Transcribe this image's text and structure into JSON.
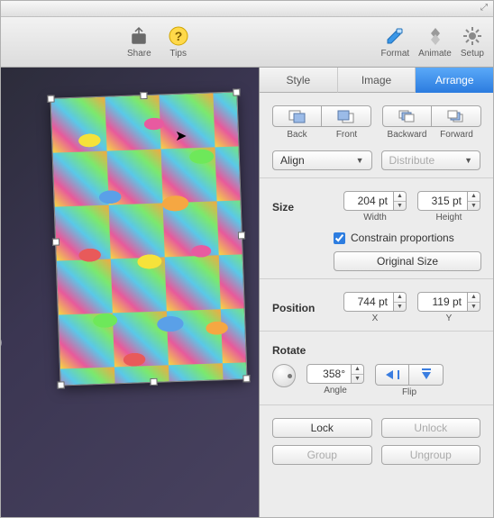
{
  "toolbar": {
    "share": "Share",
    "tips": "Tips",
    "format": "Format",
    "animate": "Animate",
    "setup": "Setup"
  },
  "inspector": {
    "tabs": {
      "style": "Style",
      "image": "Image",
      "arrange": "Arrange"
    },
    "order": {
      "back": "Back",
      "front": "Front",
      "backward": "Backward",
      "forward": "Forward"
    },
    "align": "Align",
    "distribute": "Distribute",
    "size": {
      "label": "Size",
      "width_value": "204 pt",
      "width_caption": "Width",
      "height_value": "315 pt",
      "height_caption": "Height",
      "constrain": "Constrain proportions",
      "original": "Original Size"
    },
    "position": {
      "label": "Position",
      "x_value": "744 pt",
      "x_caption": "X",
      "y_value": "119 pt",
      "y_caption": "Y"
    },
    "rotate": {
      "label": "Rotate",
      "angle_value": "358°",
      "angle_caption": "Angle",
      "flip_caption": "Flip"
    },
    "lock": "Lock",
    "unlock": "Unlock",
    "group": "Group",
    "ungroup": "Ungroup"
  },
  "canvas": {
    "bg_glyph": "e"
  }
}
